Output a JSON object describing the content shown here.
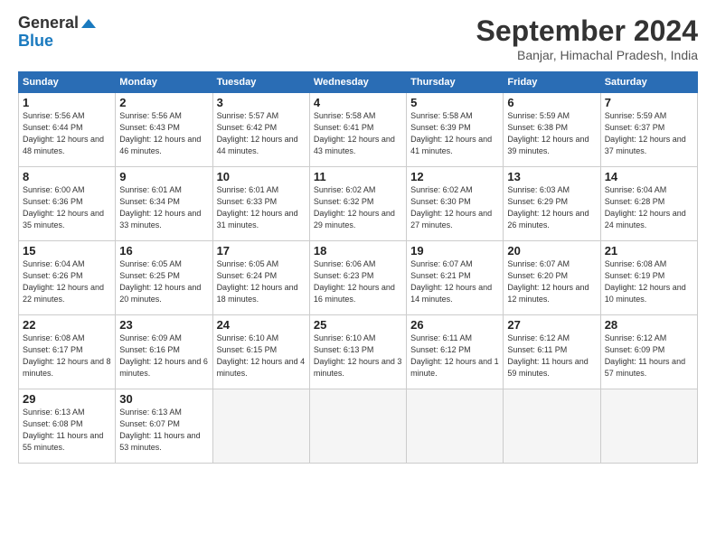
{
  "logo": {
    "line1": "General",
    "line2": "Blue"
  },
  "title": "September 2024",
  "subtitle": "Banjar, Himachal Pradesh, India",
  "days_of_week": [
    "Sunday",
    "Monday",
    "Tuesday",
    "Wednesday",
    "Thursday",
    "Friday",
    "Saturday"
  ],
  "weeks": [
    [
      {
        "day": "1",
        "sunrise": "5:56 AM",
        "sunset": "6:44 PM",
        "daylight": "12 hours and 48 minutes."
      },
      {
        "day": "2",
        "sunrise": "5:56 AM",
        "sunset": "6:43 PM",
        "daylight": "12 hours and 46 minutes."
      },
      {
        "day": "3",
        "sunrise": "5:57 AM",
        "sunset": "6:42 PM",
        "daylight": "12 hours and 44 minutes."
      },
      {
        "day": "4",
        "sunrise": "5:58 AM",
        "sunset": "6:41 PM",
        "daylight": "12 hours and 43 minutes."
      },
      {
        "day": "5",
        "sunrise": "5:58 AM",
        "sunset": "6:39 PM",
        "daylight": "12 hours and 41 minutes."
      },
      {
        "day": "6",
        "sunrise": "5:59 AM",
        "sunset": "6:38 PM",
        "daylight": "12 hours and 39 minutes."
      },
      {
        "day": "7",
        "sunrise": "5:59 AM",
        "sunset": "6:37 PM",
        "daylight": "12 hours and 37 minutes."
      }
    ],
    [
      {
        "day": "8",
        "sunrise": "6:00 AM",
        "sunset": "6:36 PM",
        "daylight": "12 hours and 35 minutes."
      },
      {
        "day": "9",
        "sunrise": "6:01 AM",
        "sunset": "6:34 PM",
        "daylight": "12 hours and 33 minutes."
      },
      {
        "day": "10",
        "sunrise": "6:01 AM",
        "sunset": "6:33 PM",
        "daylight": "12 hours and 31 minutes."
      },
      {
        "day": "11",
        "sunrise": "6:02 AM",
        "sunset": "6:32 PM",
        "daylight": "12 hours and 29 minutes."
      },
      {
        "day": "12",
        "sunrise": "6:02 AM",
        "sunset": "6:30 PM",
        "daylight": "12 hours and 27 minutes."
      },
      {
        "day": "13",
        "sunrise": "6:03 AM",
        "sunset": "6:29 PM",
        "daylight": "12 hours and 26 minutes."
      },
      {
        "day": "14",
        "sunrise": "6:04 AM",
        "sunset": "6:28 PM",
        "daylight": "12 hours and 24 minutes."
      }
    ],
    [
      {
        "day": "15",
        "sunrise": "6:04 AM",
        "sunset": "6:26 PM",
        "daylight": "12 hours and 22 minutes."
      },
      {
        "day": "16",
        "sunrise": "6:05 AM",
        "sunset": "6:25 PM",
        "daylight": "12 hours and 20 minutes."
      },
      {
        "day": "17",
        "sunrise": "6:05 AM",
        "sunset": "6:24 PM",
        "daylight": "12 hours and 18 minutes."
      },
      {
        "day": "18",
        "sunrise": "6:06 AM",
        "sunset": "6:23 PM",
        "daylight": "12 hours and 16 minutes."
      },
      {
        "day": "19",
        "sunrise": "6:07 AM",
        "sunset": "6:21 PM",
        "daylight": "12 hours and 14 minutes."
      },
      {
        "day": "20",
        "sunrise": "6:07 AM",
        "sunset": "6:20 PM",
        "daylight": "12 hours and 12 minutes."
      },
      {
        "day": "21",
        "sunrise": "6:08 AM",
        "sunset": "6:19 PM",
        "daylight": "12 hours and 10 minutes."
      }
    ],
    [
      {
        "day": "22",
        "sunrise": "6:08 AM",
        "sunset": "6:17 PM",
        "daylight": "12 hours and 8 minutes."
      },
      {
        "day": "23",
        "sunrise": "6:09 AM",
        "sunset": "6:16 PM",
        "daylight": "12 hours and 6 minutes."
      },
      {
        "day": "24",
        "sunrise": "6:10 AM",
        "sunset": "6:15 PM",
        "daylight": "12 hours and 4 minutes."
      },
      {
        "day": "25",
        "sunrise": "6:10 AM",
        "sunset": "6:13 PM",
        "daylight": "12 hours and 3 minutes."
      },
      {
        "day": "26",
        "sunrise": "6:11 AM",
        "sunset": "6:12 PM",
        "daylight": "12 hours and 1 minute."
      },
      {
        "day": "27",
        "sunrise": "6:12 AM",
        "sunset": "6:11 PM",
        "daylight": "11 hours and 59 minutes."
      },
      {
        "day": "28",
        "sunrise": "6:12 AM",
        "sunset": "6:09 PM",
        "daylight": "11 hours and 57 minutes."
      }
    ],
    [
      {
        "day": "29",
        "sunrise": "6:13 AM",
        "sunset": "6:08 PM",
        "daylight": "11 hours and 55 minutes."
      },
      {
        "day": "30",
        "sunrise": "6:13 AM",
        "sunset": "6:07 PM",
        "daylight": "11 hours and 53 minutes."
      },
      null,
      null,
      null,
      null,
      null
    ]
  ]
}
